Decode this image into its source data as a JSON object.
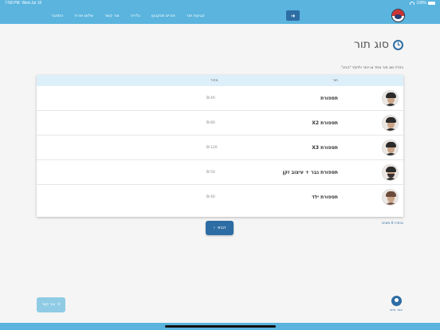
{
  "statusbar": {
    "time": "7:58 PM",
    "date": "Wed Jul 10",
    "battery": "100%"
  },
  "nav": {
    "items": [
      "קביעת תור",
      "תורים שנקבעו",
      "גלריה",
      "צור קשר",
      "שלום אורח",
      "התחבר"
    ]
  },
  "page": {
    "title": "סוג תור",
    "instruction": "בחר/י סוג תור אחד או יותר ולחץ/י \"הבא\"."
  },
  "table": {
    "headers": {
      "treatment": "תור",
      "price": "מחיר"
    },
    "rows": [
      {
        "name": "תספורת",
        "price": "40 ₪"
      },
      {
        "name": "תספורת X2",
        "price": "80 ₪"
      },
      {
        "name": "תספורת X3",
        "price": "120 ₪"
      },
      {
        "name": "תספורת גבר + עיצוב זקן",
        "price": "50 ₪"
      },
      {
        "name": "תספורת ילד",
        "price": "40 ₪"
      }
    ]
  },
  "footer": {
    "selected_count": "נבחרו 0 סוגים",
    "next_label": "הבא",
    "contact_label": "צור קשר",
    "account_label": "אזור אישי"
  },
  "colors": {
    "accent": "#5ab4de",
    "primary": "#2e6da4"
  },
  "icons": {
    "title": "clock-icon",
    "next": "chevron-left-icon",
    "contact": "phone-icon",
    "account": "user-icon"
  }
}
